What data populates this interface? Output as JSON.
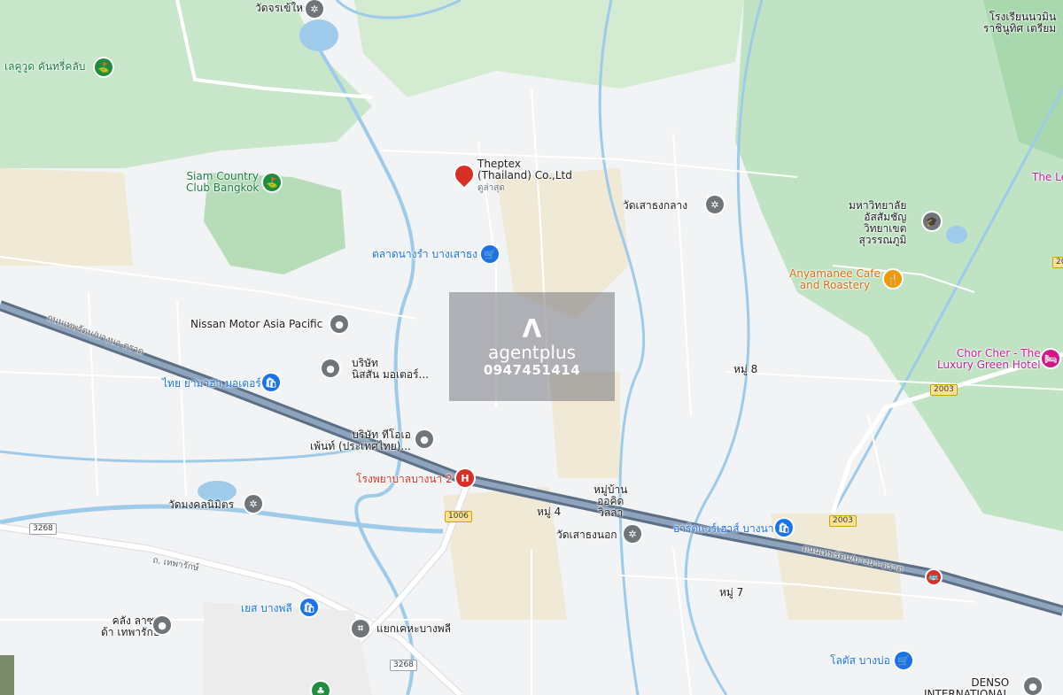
{
  "places": {
    "wat_chorakhe_yai": "วัดจรเข้ใหญ่",
    "lakewood": "เลคูวูด คันทรี่คลับ",
    "siam_country_club": "Siam Country\nClub Bangkok",
    "theptex": "Theptex\n(Thailand) Co.,Ltd",
    "theptex_sub": "ดูล่าสุด",
    "wat_saothong_klang": "วัดเสาธงกลาง",
    "talad_nang_ram": "ตลาดนางรำ บางเสาธง",
    "nissan": "Nissan Motor Asia Pacific",
    "nissan_thai": "บริษัท\nนิสสัน มอเตอร์...",
    "thai_yamaha": "ไทย ยามาฮ่า มอเตอร์",
    "tiger_paint": "บริษัท ทีโอเอ\nเพ้นท์ (ประเทศไทย)...",
    "hospital": "โรงพยาบาลบางนา 2",
    "wat_mongkhon": "วัดมงคลนิมิตร",
    "moo_ban": "หมู่บ้าน\nออคิด\nวิลล่า",
    "moo4": "หมู่ 4",
    "wat_saothong_nok": "วัดเสาธงนอก",
    "moo8": "หมู่ 8",
    "moo7": "หมู่ 7",
    "arts_warehouse": "อาร์ตแวร์เฮาส์ บางนา",
    "mahawitthayalai": "มหาวิทยาลัย\nอัสสัมชัญ\nวิทยาเขต\nสุวรรณภูมิ",
    "anyamanee": "Anyamanee Cafe\nand Roastery",
    "chor_cher": "Chor Cher - The\nLuxury Green Hotel",
    "the_le": "The Le",
    "school": "โรงเรียนนวมิน\nราชินูทิศ เตรียม",
    "khlang_satha": "คลัง ลาซา\nด้า เทพารักษ์",
    "yes_bangphli": "เยส บางพลี",
    "yaek_kheha": "แยกเคหะบางพลี",
    "lotus": "โลตัส บางบ่อ",
    "denso": "DENSO\nINTERNATIONAL",
    "road_thepharak": "ถ. เทพารักษ์",
    "road_bangna_1": "ถนนเทพรัตน/บางนา-ตราด",
    "road_bangna_2": "ถนนเทพรัตน/บางนา-ตราด"
  },
  "shields": {
    "r1006": "1006",
    "r3268a": "3268",
    "r3268b": "3268",
    "r2003a": "2003",
    "r2003b": "2003",
    "r20": "20"
  },
  "watermark": {
    "logo": "Λ",
    "brand": "agentplus",
    "phone": "0947451414"
  }
}
